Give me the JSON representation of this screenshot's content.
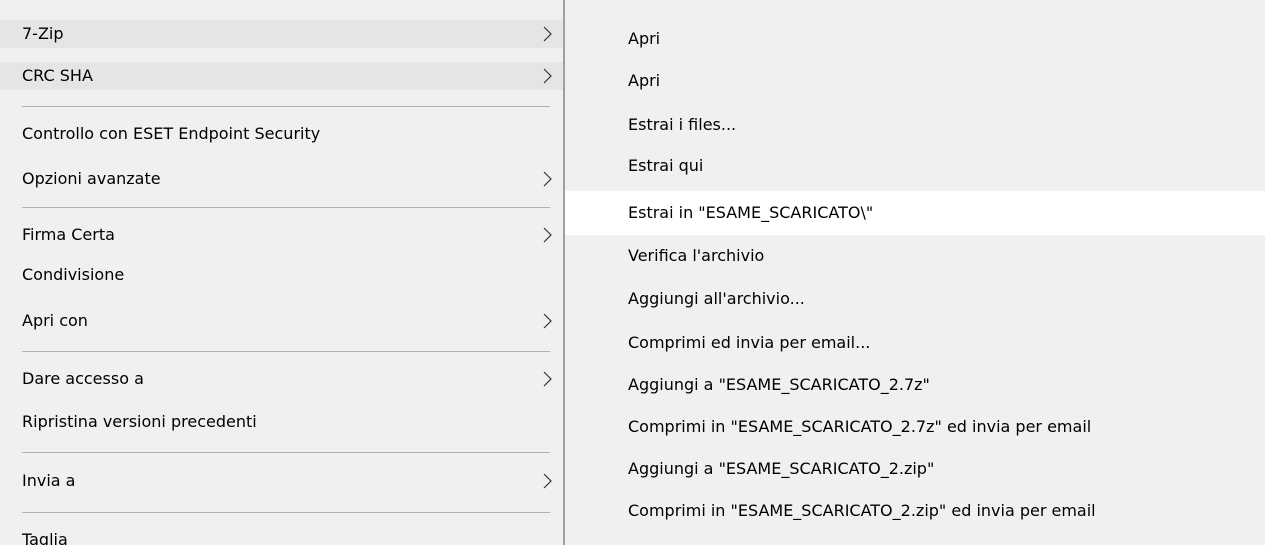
{
  "left_menu": {
    "items": [
      {
        "label": "7-Zip"
      },
      {
        "label": "CRC SHA"
      },
      {
        "label": "Controllo con ESET Endpoint Security"
      },
      {
        "label": "Opzioni avanzate"
      },
      {
        "label": "Firma Certa"
      },
      {
        "label": "Condivisione"
      },
      {
        "label": "Apri con"
      },
      {
        "label": "Dare accesso a"
      },
      {
        "label": "Ripristina versioni precedenti"
      },
      {
        "label": "Invia a"
      },
      {
        "label": "Taglia"
      }
    ]
  },
  "submenu": {
    "items": [
      {
        "label": "Apri"
      },
      {
        "label": "Apri"
      },
      {
        "label": "Estrai i files..."
      },
      {
        "label": "Estrai qui"
      },
      {
        "label": "Estrai in \"ESAME_SCARICATO\\\""
      },
      {
        "label": "Verifica l'archivio"
      },
      {
        "label": "Aggiungi all'archivio..."
      },
      {
        "label": "Comprimi ed invia per email..."
      },
      {
        "label": "Aggiungi a \"ESAME_SCARICATO_2.7z\""
      },
      {
        "label": "Comprimi in \"ESAME_SCARICATO_2.7z\" ed invia per email"
      },
      {
        "label": "Aggiungi a \"ESAME_SCARICATO_2.zip\""
      },
      {
        "label": "Comprimi in \"ESAME_SCARICATO_2.zip\" ed invia per email"
      }
    ],
    "selected_index": 4
  },
  "icons": {
    "submenu_arrow": "chevron-right-icon"
  },
  "colors": {
    "menu_bg": "#f0f0f0",
    "hover_bg": "#e5e5e5",
    "selected_bg": "#ffffff",
    "separator": "#b0b0b0"
  }
}
